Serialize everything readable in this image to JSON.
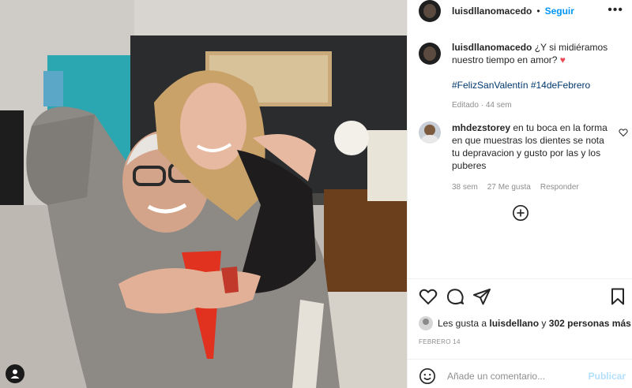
{
  "post": {
    "username": "luisdllanomacedo",
    "follow_label": "Seguir",
    "more_label": "•••",
    "caption": {
      "username": "luisdllanomacedo",
      "text": "¿Y si midiéramos nuestro tiempo en amor?",
      "heart": "♥",
      "hashtags": "#FelizSanValentín #14deFebrero",
      "edited": "Editado",
      "age": "44 sem"
    },
    "comments": [
      {
        "username": "mhdezstorey",
        "text": "en tu boca en la forma en que muestras los dientes se nota tu depravacion y gusto por las y los puberes",
        "age": "38 sem",
        "likes": "27 Me gusta",
        "reply": "Responder"
      }
    ],
    "likes_prefix": "Les gusta a",
    "likes_user": "luisdellano",
    "likes_joiner": "y",
    "likes_others": "302 personas más",
    "date": "FEBRERO 14",
    "comment_placeholder": "Añade un comentario...",
    "publish_label": "Publicar"
  },
  "icons": {
    "more": "more-comments-plus-icon",
    "like": "heart-icon",
    "comment": "comment-icon",
    "share": "send-icon",
    "save": "bookmark-icon",
    "emoji": "emoji-icon"
  },
  "colors": {
    "link": "#0095f6",
    "hashtag": "#00376b",
    "heart": "#ed4956",
    "muted": "#8e8e8e",
    "publish_disabled": "#b2dffc"
  }
}
